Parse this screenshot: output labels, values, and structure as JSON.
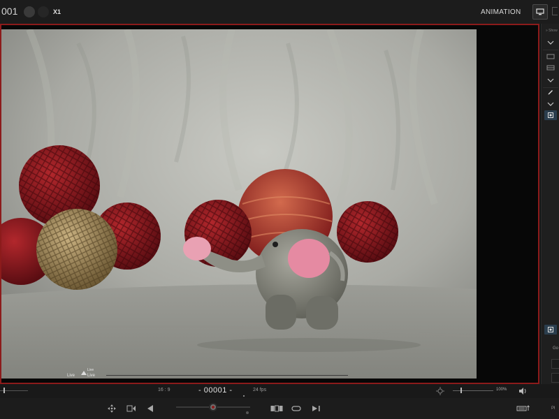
{
  "topbar": {
    "frame_counter": "001",
    "speed": "X1",
    "mode": "ANIMATION"
  },
  "viewer": {
    "live_left": "Live",
    "live_right_top": "Live",
    "live_right_bottom": "Live"
  },
  "right_panel": {
    "title": "» Show",
    "label_go": "Go",
    "label_pl": "Pl"
  },
  "playback": {
    "aspect_ratio": "16 : 9",
    "frame_display": "- 00001 -",
    "fps": "24 fps",
    "zoom_value": "100%",
    "zoom_level": 0.2,
    "volume_level": 0.15,
    "timeline_position": 0.5
  },
  "colors": {
    "accent_red": "#8c1b1b",
    "panel_bg": "#1c1c1c",
    "active_tool": "#2b3e4e"
  },
  "icons": [
    "onion-skin-icon",
    "monitor-icon",
    "chevron-down-icon",
    "rectangle-icon",
    "pencil-icon",
    "camera-icon",
    "move-icon",
    "frame-back-icon",
    "play-back-icon",
    "film-strip-icon",
    "loop-icon",
    "play-forward-icon",
    "keyboard-icon",
    "speaker-icon",
    "zoom-icon"
  ]
}
